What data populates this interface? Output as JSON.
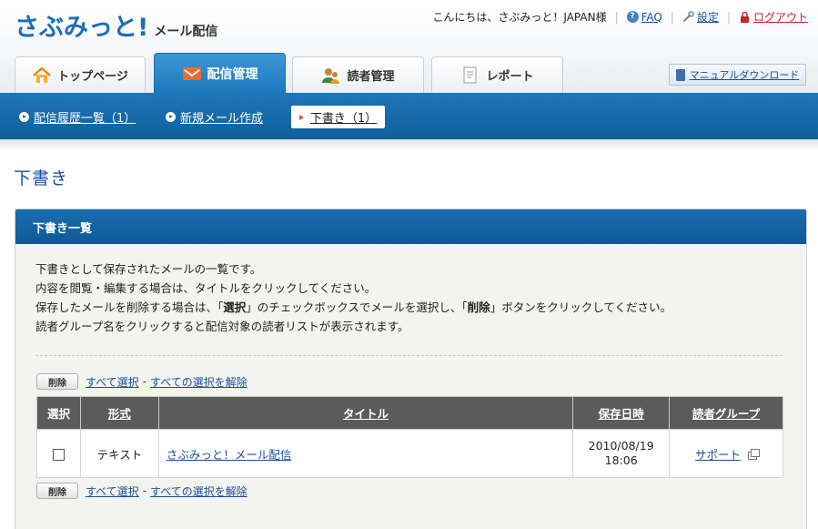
{
  "header": {
    "logo_main": "さぶみっと!",
    "logo_sub": "メール配信",
    "greeting": "こんにちは、さぶみっと！JAPAN様",
    "faq_label": "FAQ",
    "faq_icon": "?",
    "settings_label": "設定",
    "logout_label": "ログアウト"
  },
  "tabs": [
    {
      "label": "トップページ",
      "icon": "home-icon"
    },
    {
      "label": "配信管理",
      "icon": "mail-icon",
      "active": true
    },
    {
      "label": "読者管理",
      "icon": "users-icon"
    },
    {
      "label": "レポート",
      "icon": "report-icon"
    }
  ],
  "manual_download": "マニュアルダウンロード",
  "subnav": {
    "history": "配信履歴一覧（1）",
    "new_mail": "新規メール作成",
    "drafts": "下書き（1）"
  },
  "page_title": "下書き",
  "panel": {
    "title": "下書き一覧",
    "desc": {
      "line1": "下書きとして保存されたメールの一覧です。",
      "line2": "内容を閲覧・編集する場合は、タイトルをクリックしてください。",
      "line3_pre": "保存したメールを削除する場合は、「",
      "line3_b1": "選択",
      "line3_mid": "」のチェックボックスでメールを選択し、「",
      "line3_b2": "削除",
      "line3_post": "」ボタンをクリックしてください。",
      "line4": "読者グループ名をクリックすると配信対象の読者リストが表示されます。"
    },
    "delete_button": "削除",
    "select_all": "すべて選択",
    "deselect_all": "すべての選択を解除",
    "dash": "-"
  },
  "table": {
    "headers": {
      "select": "選択",
      "format": "形式",
      "title": "タイトル",
      "saved_at": "保存日時",
      "group": "読者グループ"
    },
    "rows": [
      {
        "format": "テキスト",
        "title": "さぶみっと！メール配信",
        "date": "2010/08/19",
        "time": "18:06",
        "group": "サポート"
      }
    ]
  },
  "colors": {
    "brand_blue": "#1f6db8",
    "nav_blue": "#1e77b9",
    "logout_red": "#c0282b",
    "table_header": "#5b5b5b"
  }
}
